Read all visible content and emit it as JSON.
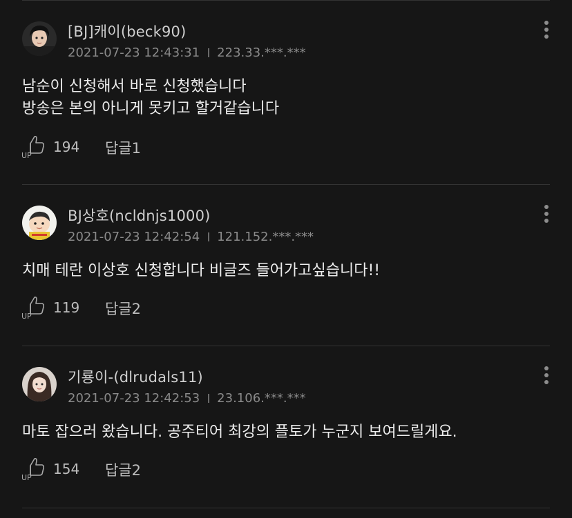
{
  "comments": [
    {
      "author": "[BJ]캐이(beck90)",
      "date": "2021-07-23 12:43:31",
      "ip": "223.33.***.***",
      "lines": [
        "남순이 신청해서 바로 신청했습니다",
        "방송은 본의 아니게 못키고 할거같습니다"
      ],
      "up_count": "194",
      "reply_label": "답글1"
    },
    {
      "author": "BJ상호(ncldnjs1000)",
      "date": "2021-07-23 12:42:54",
      "ip": "121.152.***.***",
      "lines": [
        "치매 테란 이상호 신청합니다 비글즈 들어가고싶습니다!!"
      ],
      "up_count": "119",
      "reply_label": "답글2"
    },
    {
      "author": "기룡이-(dlrudals11)",
      "date": "2021-07-23 12:42:53",
      "ip": "23.106.***.***",
      "lines": [
        "마토 잡으러 왔습니다. 공주티어 최강의 플토가 누군지 보여드릴게요."
      ],
      "up_count": "154",
      "reply_label": "답글2"
    }
  ],
  "icons": {
    "up": "thumbs-up-icon",
    "more": "more-vertical-icon"
  },
  "colors": {
    "background": "#161616",
    "divider": "#333333",
    "text_primary": "#ececec",
    "text_secondary": "#8a8a8a"
  }
}
